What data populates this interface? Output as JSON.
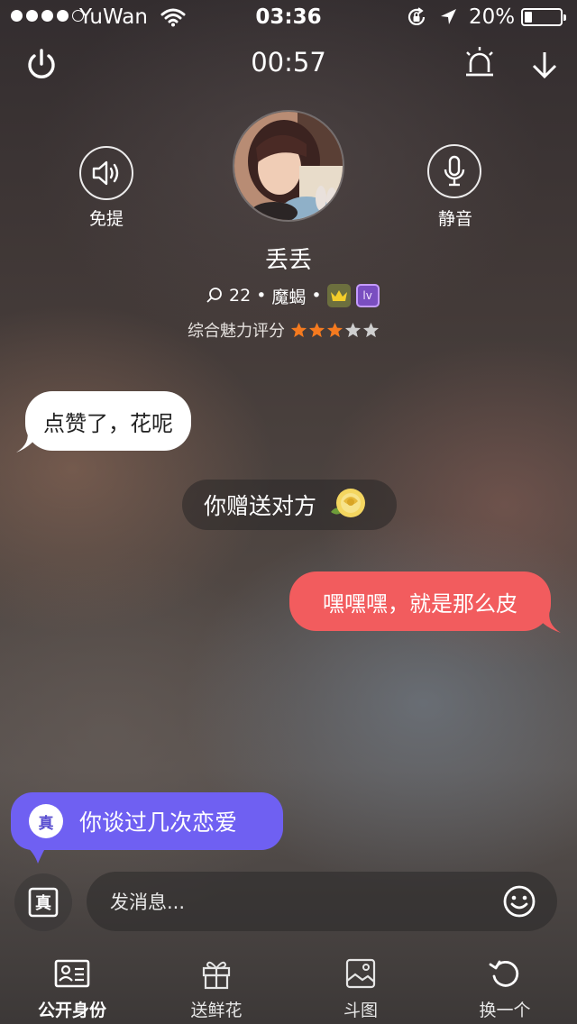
{
  "status_bar": {
    "carrier": "YuWan",
    "time": "03:36",
    "battery_percent": "20%",
    "battery_level": 0.2,
    "signal_bars": 4,
    "icons": [
      "wifi-icon",
      "rotation-lock-icon",
      "location-arrow-icon",
      "battery-icon"
    ]
  },
  "call": {
    "timer": "00:57",
    "speaker_label": "免提",
    "mute_label": "静音"
  },
  "profile": {
    "name": "丢丢",
    "age": "22",
    "sign": "魔蝎",
    "dot": "•",
    "level_badge": "lv",
    "rating_label": "综合魅力评分",
    "rating_stars": 3,
    "rating_max": 5
  },
  "messages": {
    "incoming": "点赞了，花呢",
    "system": "你赠送对方",
    "outgoing": "嘿嘿嘿，就是那么皮"
  },
  "truth_prompt": {
    "icon_text": "真",
    "question": "你谈过几次恋爱"
  },
  "input": {
    "placeholder": "发消息..."
  },
  "tabs": [
    {
      "label": "公开身份",
      "active": true
    },
    {
      "label": "送鲜花",
      "active": false
    },
    {
      "label": "斗图",
      "active": false
    },
    {
      "label": "换一个",
      "active": false
    }
  ],
  "colors": {
    "outgoing_bubble": "#f25c5e",
    "truth_bubble": "#6f60f2",
    "star_on": "#f57a1f",
    "star_off": "#cfcfcf"
  }
}
